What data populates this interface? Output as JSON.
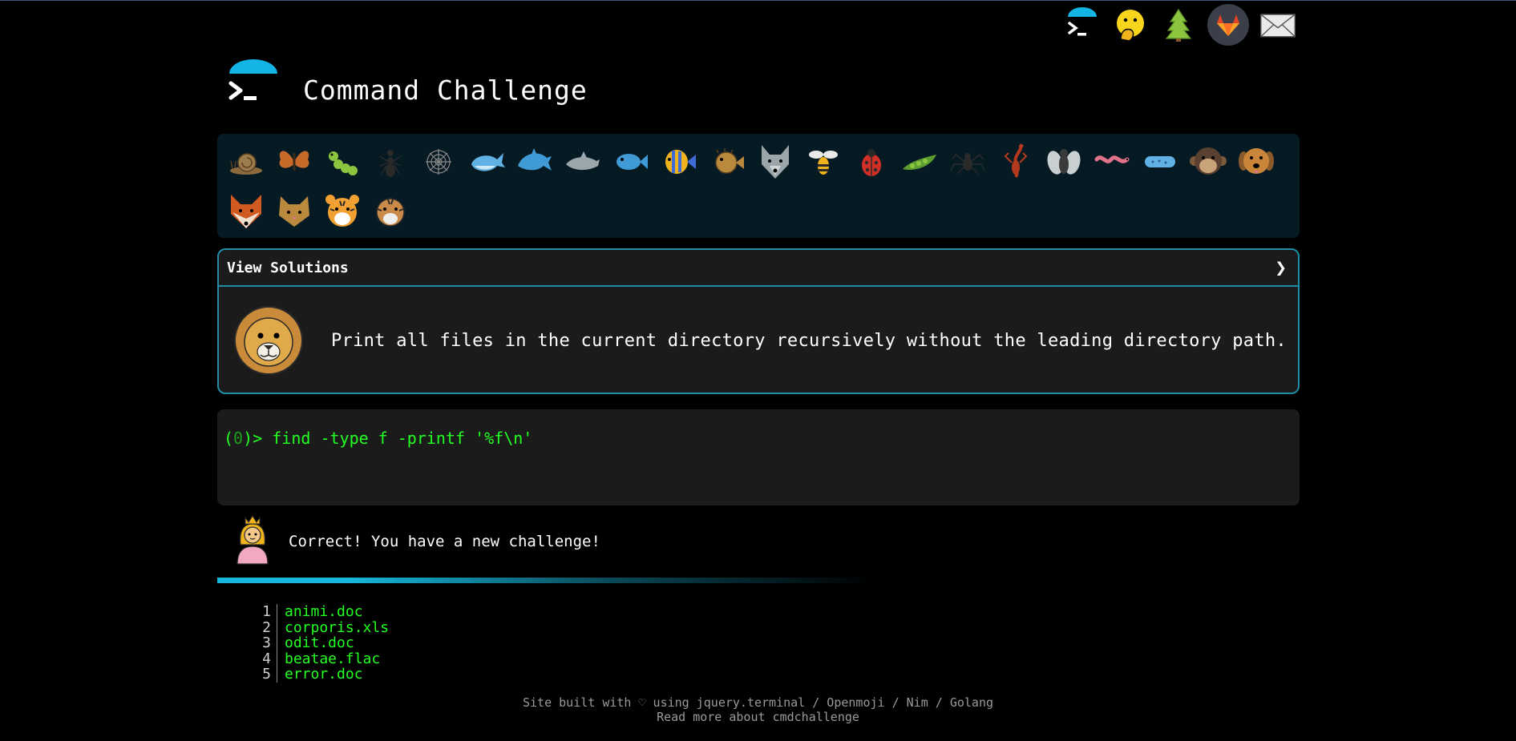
{
  "app": {
    "title": "Command Challenge"
  },
  "top_icons": [
    "terminal-logo-icon",
    "face-hand-over-mouth-icon",
    "evergreen-tree-icon",
    "gitlab-icon",
    "envelope-icon"
  ],
  "animals": {
    "row1": [
      "snail",
      "butterfly",
      "caterpillar",
      "ant",
      "spider-web",
      "whale",
      "dolphin",
      "dolphin-gray",
      "fish",
      "tropical-fish",
      "blowfish",
      "wolf",
      "bee",
      "lady-beetle",
      "pea-pod",
      "spider",
      "scorpion",
      "fly",
      "worm",
      "microbe",
      "monkey-face",
      "dog-face"
    ],
    "row2": [
      "fox-face",
      "cat-face",
      "tiger-face",
      "tiger-face-outline"
    ]
  },
  "challenge": {
    "header": "View Solutions",
    "chevron": "❯",
    "description": "Print all files in the current directory recursively without the leading directory path."
  },
  "terminal": {
    "prompt_open": "(",
    "prompt_num": "0",
    "prompt_close": ")>",
    "command": "find -type f -printf '%f\\n'"
  },
  "result": {
    "message": "Correct! You have a new challenge!"
  },
  "output": [
    {
      "n": "1",
      "text": "animi.doc"
    },
    {
      "n": "2",
      "text": "corporis.xls"
    },
    {
      "n": "3",
      "text": "odit.doc"
    },
    {
      "n": "4",
      "text": "beatae.flac"
    },
    {
      "n": "5",
      "text": "error.doc"
    }
  ],
  "footer": {
    "line1": "Site built with ♡ using jquery.terminal / Openmoji / Nim / Golang",
    "line2": "Read more about cmdchallenge"
  },
  "colors": {
    "accent": "#1d8ea5",
    "terminal_green": "#22ff22",
    "panel_bg": "#061a24"
  }
}
